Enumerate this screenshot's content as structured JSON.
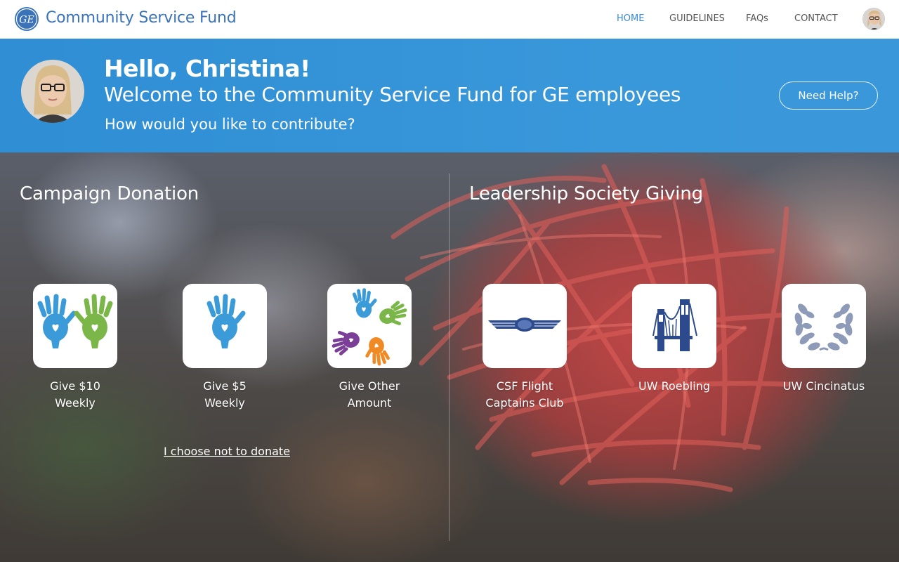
{
  "header": {
    "title": "Community Service Fund",
    "logo_text": "GE",
    "nav": [
      {
        "label": "HOME",
        "active": true
      },
      {
        "label": "GUIDELINES",
        "active": false
      },
      {
        "label": "FAQs",
        "active": false
      },
      {
        "label": "CONTACT",
        "active": false
      }
    ],
    "avatar_icon": "user-avatar-icon"
  },
  "banner": {
    "greeting": "Hello, Christina!",
    "welcome": "Welcome to the Community Service Fund for GE employees",
    "question": "How would you like to contribute?",
    "help_label": "Need Help?",
    "avatar_icon": "user-avatar-icon"
  },
  "campaign": {
    "title": "Campaign Donation",
    "options": [
      {
        "label_line1": "Give $10",
        "label_line2": "Weekly",
        "icon": "two-hands-icon"
      },
      {
        "label_line1": "Give $5",
        "label_line2": "Weekly",
        "icon": "one-hand-icon"
      },
      {
        "label_line1": "Give Other",
        "label_line2": "Amount",
        "icon": "four-hands-icon"
      }
    ],
    "decline_label": "I choose not to donate"
  },
  "leadership": {
    "title": "Leadership Society Giving",
    "options": [
      {
        "label_line1": "CSF Flight",
        "label_line2": "Captains Club",
        "icon": "pilot-wings-icon"
      },
      {
        "label_line1": "UW Roebling",
        "label_line2": "",
        "icon": "bridge-icon"
      },
      {
        "label_line1": "UW Cincinatus",
        "label_line2": "",
        "icon": "laurel-wreath-icon"
      }
    ]
  },
  "colors": {
    "brand_blue": "#3b73b9",
    "banner_blue": "#3393d6",
    "nav_active": "#3b8bd4",
    "hand_blue": "#3a9bd8",
    "hand_green": "#7ab648",
    "hand_purple": "#7b3f98",
    "hand_orange": "#f08a24",
    "icon_navy": "#2c4a8c"
  }
}
